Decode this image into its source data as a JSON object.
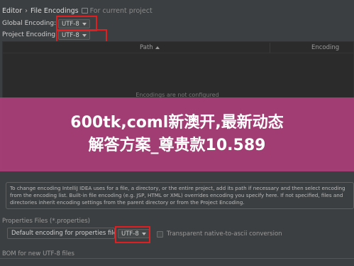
{
  "breadcrumb": {
    "parent": "Editor",
    "separator": "›",
    "current": "File Encodings",
    "scope": "For current project"
  },
  "global_encoding": {
    "label": "Global Encoding:",
    "value": "UTF-8"
  },
  "project_encoding": {
    "label": "Project Encoding:",
    "value": "UTF-8"
  },
  "table": {
    "columns": [
      "Path",
      "Encoding"
    ],
    "empty_text": "Encodings are not configured"
  },
  "banner": {
    "line1": "600tk,coml新澳开,最新动态",
    "line2": "解答方案_尊贵款10.589"
  },
  "info_text": "To change encoding IntelliJ IDEA uses for a file, a directory, or the entire project, add its path if necessary and then select encoding from the encoding list. Built-in file encoding (e.g. JSP, HTML or XML) overrides encoding you specify here. If not specified, files and directories inherit encoding settings from the parent directory or from the Project Encoding.",
  "properties": {
    "section_label": "Properties Files (*.properties)",
    "field_label": "Default encoding for properties files:",
    "value": "UTF-8",
    "checkbox_label": "Transparent native-to-ascii conversion",
    "checkbox_checked": false
  },
  "bom": {
    "section_label": "BOM for new UTF-8 files"
  },
  "colors": {
    "background": "#3c3f41",
    "highlight_box": "#e02020",
    "banner": "#aa3e78"
  }
}
